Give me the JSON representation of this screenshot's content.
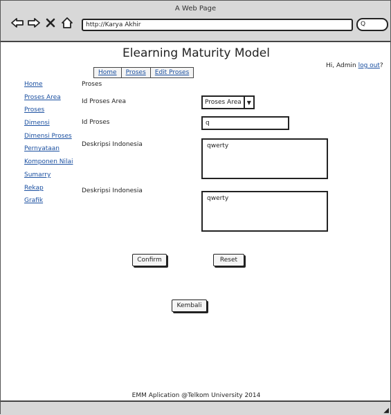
{
  "browser": {
    "window_title": "A Web Page",
    "url": "http://Karya Akhir",
    "search_text": "Q"
  },
  "app": {
    "title": "Elearning Maturity Model",
    "greeting_prefix": "Hi, Admin",
    "logout_label": "log out",
    "greeting_suffix": "?"
  },
  "tabs": [
    "Home",
    "Proses",
    "Edit Proses"
  ],
  "sidebar": {
    "items": [
      {
        "label": "Home"
      },
      {
        "label": "Proses Area"
      },
      {
        "label": "Proses"
      },
      {
        "label": "Dimensi"
      },
      {
        "label": "Dimensi Proses"
      },
      {
        "label": "Pernyataan"
      },
      {
        "label": "Komponen Nilai"
      },
      {
        "label": "Sumarry"
      },
      {
        "label": "Rekap"
      },
      {
        "label": "Grafik"
      }
    ]
  },
  "form": {
    "section_title": "Proses",
    "id_proses_area_label": "Id Proses Area",
    "id_proses_area_value": "Proses Area",
    "id_proses_label": "Id Proses",
    "id_proses_value": "q",
    "deskripsi1_label": "Deskripsi Indonesia",
    "deskripsi1_value": "qwerty",
    "deskripsi2_label": "Deskripsi Indonesia",
    "deskripsi2_value": "qwerty"
  },
  "buttons": {
    "confirm": "Confirm",
    "reset": "Reset",
    "back": "Kembali"
  },
  "footer": {
    "text": "EMM Aplication @Telkom University 2014"
  }
}
